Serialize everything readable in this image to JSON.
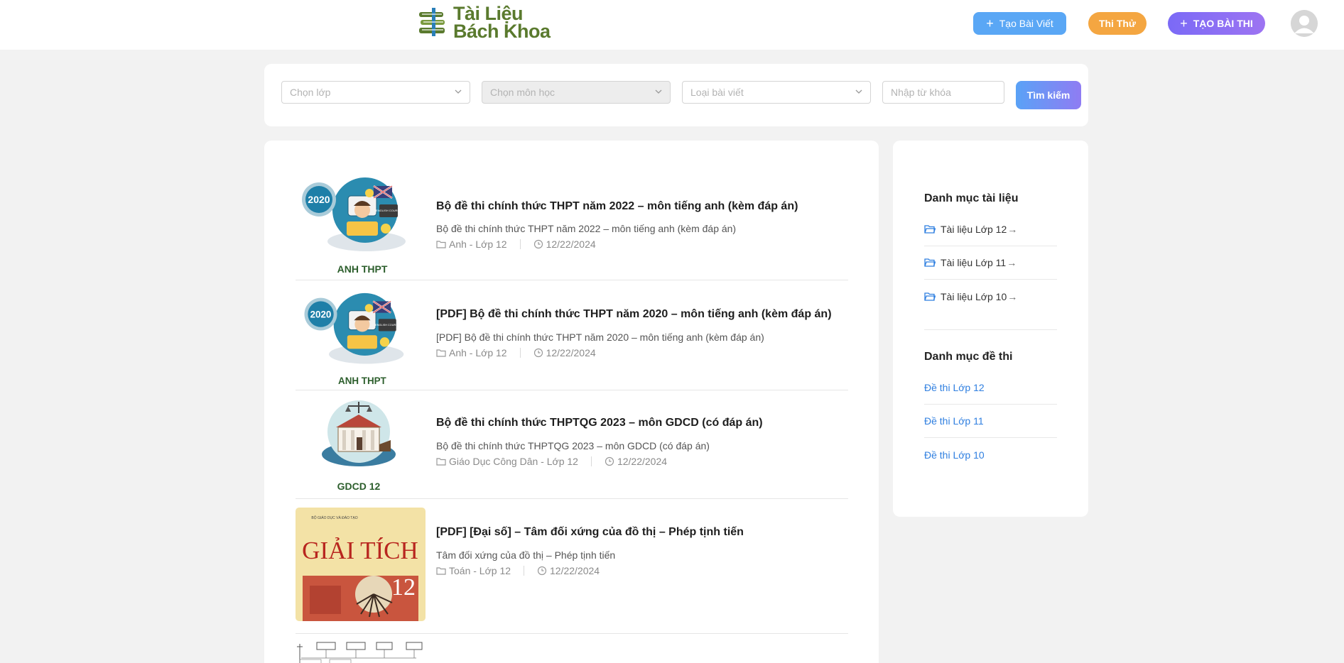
{
  "header": {
    "logo_line1": "Tài Liệu",
    "logo_line2": "Bách Khoa",
    "create_post_label": "Tạo Bài Viết",
    "trial_label": "Thi Thử",
    "create_exam_label": "TẠO BÀI THI"
  },
  "search": {
    "class_placeholder": "Chọn lớp",
    "subject_placeholder": "Chọn môn học",
    "type_placeholder": "Loại bài viết",
    "keyword_placeholder": "Nhập từ khóa",
    "search_label": "Tìm kiếm"
  },
  "posts": [
    {
      "title": "Bộ đề thi chính thức THPT năm 2022 – môn tiếng anh (kèm đáp án)",
      "desc": "Bộ đề thi chính thức THPT năm 2022 – môn tiếng anh (kèm đáp án)",
      "category": "Anh - Lớp 12",
      "date": "12/22/2024",
      "thumb_badge": "2020",
      "thumb_caption": "ANH THPT",
      "thumb_book": "ENGLISH COURSE"
    },
    {
      "title": "[PDF] Bộ đề thi chính thức THPT năm 2020 – môn tiếng anh (kèm đáp án)",
      "desc": "[PDF] Bộ đề thi chính thức THPT năm 2020 – môn tiếng anh (kèm đáp án)",
      "category": "Anh - Lớp 12",
      "date": "12/22/2024",
      "thumb_badge": "2020",
      "thumb_caption": "ANH THPT",
      "thumb_book": "ENGLISH COURSE"
    },
    {
      "title": "Bộ đề thi chính thức THPTQG 2023 – môn GDCD (có đáp án)",
      "desc": "Bộ đề thi chính thức THPTQG 2023 – môn GDCD (có đáp án)",
      "category": "Giáo Dục Công Dân - Lớp 12",
      "date": "12/22/2024",
      "thumb_caption": "GDCD 12"
    },
    {
      "title": "[PDF] [Đại số] – Tâm đối xứng của đồ thị – Phép tịnh tiến",
      "desc": "Tâm đối xứng của đồ thị – Phép tịnh tiến",
      "category": "Toán - Lớp 12",
      "date": "12/22/2024",
      "thumb_publisher": "BỘ GIÁO DỤC VÀ ĐÀO TẠO",
      "thumb_title": "GIẢI TÍCH",
      "thumb_grade": "12"
    }
  ],
  "sidebar": {
    "docs_heading": "Danh mục tài liệu",
    "docs": [
      "Tài liệu Lớp 12",
      "Tài liệu Lớp 11",
      "Tài liệu Lớp 10"
    ],
    "exams_heading": "Danh mục đề thi",
    "exams": [
      "Đề thi Lớp 12",
      "Đề thi Lớp 11",
      "Đề thi Lớp 10"
    ]
  },
  "colors": {
    "logo_green": "#5a7a2e",
    "create_post_blue": "#5aa7f5",
    "trial_orange": "#f4a641",
    "create_exam_purple": "#8a6ff5",
    "link_blue": "#2f7fe0"
  },
  "icons": [
    "logo-books-icon",
    "plus-icon",
    "chevron-down-icon",
    "folder-icon",
    "clock-icon",
    "arrow-right-icon",
    "user-avatar-icon"
  ]
}
